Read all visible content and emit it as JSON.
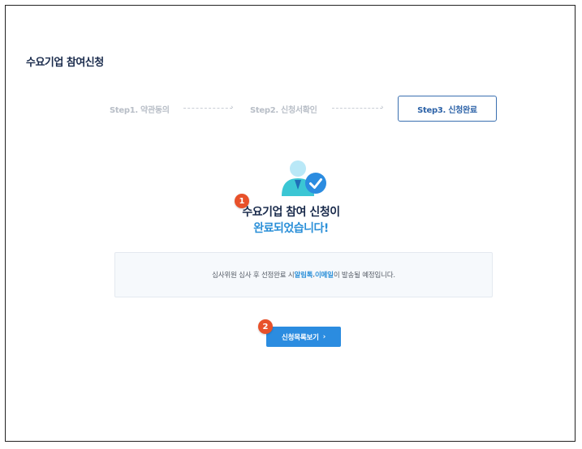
{
  "page": {
    "title": "수요기업 참여신청"
  },
  "steps": [
    {
      "label": "Step1. 약관동의",
      "active": false
    },
    {
      "label": "Step2. 신청서확인",
      "active": false
    },
    {
      "label": "Step3. 신청완료",
      "active": true
    }
  ],
  "icons": {
    "complete": "user-check-icon",
    "arrow": "arrow-right-icon",
    "chevron": "chevron-right-icon"
  },
  "badges": {
    "one": "1",
    "two": "2"
  },
  "message": {
    "line1": "수요기업 참여 신청이",
    "line2": "완료되었습니다!"
  },
  "info": {
    "prefix": "심사위원 심사 후 선정완료 시 ",
    "highlight1": "알림톡",
    "separator": ", ",
    "highlight2": "이메일",
    "suffix": " 이 발송될 예정입니다."
  },
  "button": {
    "label": "신청목록보기",
    "chevron": "›"
  },
  "colors": {
    "accent": "#2b8ce0",
    "title": "#1a2b4c",
    "badge": "#e8512a",
    "highlight": "#2a8fd8"
  }
}
